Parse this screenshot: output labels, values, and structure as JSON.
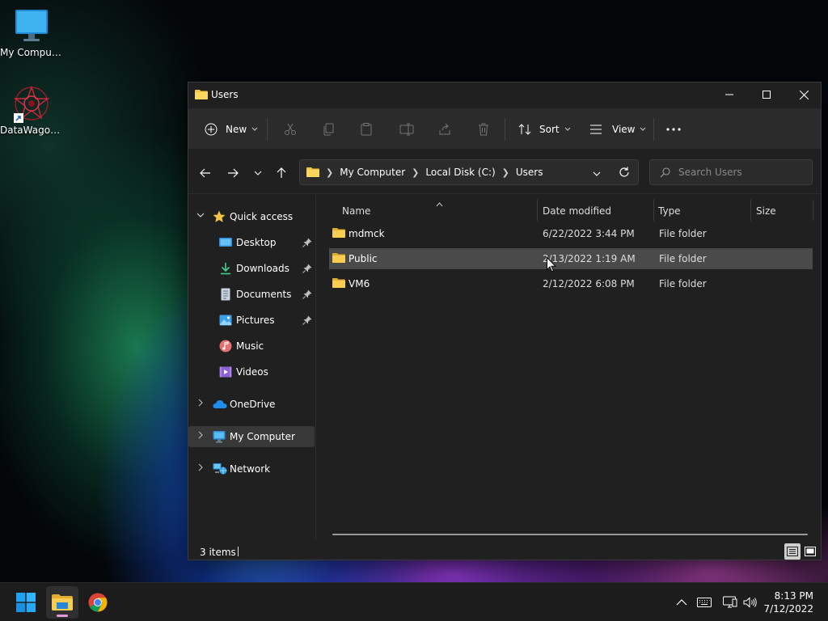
{
  "desktop": {
    "icons": [
      {
        "label": "My Computer",
        "icon": "monitor-icon"
      },
      {
        "label": "DataWagon...",
        "icon": "datawagon-app-icon"
      }
    ]
  },
  "window": {
    "title": "Users",
    "controls": {
      "minimize": "minimize-icon",
      "maximize": "maximize-icon",
      "close": "close-icon"
    }
  },
  "toolbar": {
    "new_label": "New",
    "sort_label": "Sort",
    "view_label": "View",
    "disabled_actions": [
      "cut",
      "copy",
      "paste",
      "rename",
      "share",
      "delete"
    ]
  },
  "address": {
    "crumbs": [
      "My Computer",
      "Local Disk (C:)",
      "Users"
    ],
    "search_placeholder": "Search Users"
  },
  "nav": {
    "quick_access": "Quick access",
    "items": [
      {
        "label": "Desktop",
        "pinned": true
      },
      {
        "label": "Downloads",
        "pinned": true
      },
      {
        "label": "Documents",
        "pinned": true
      },
      {
        "label": "Pictures",
        "pinned": true
      },
      {
        "label": "Music",
        "pinned": false
      },
      {
        "label": "Videos",
        "pinned": false
      }
    ],
    "onedrive": "OneDrive",
    "my_computer": "My Computer",
    "network": "Network",
    "selected": "My Computer"
  },
  "files": {
    "columns": [
      "Name",
      "Date modified",
      "Type",
      "Size"
    ],
    "sort_column": "Name",
    "rows": [
      {
        "name": "mdmck",
        "date": "6/22/2022 3:44 PM",
        "type": "File folder",
        "size": ""
      },
      {
        "name": "Public",
        "date": "2/13/2022 1:19 AM",
        "type": "File folder",
        "size": ""
      },
      {
        "name": "VM6",
        "date": "2/12/2022 6:08 PM",
        "type": "File folder",
        "size": ""
      }
    ],
    "hovered": "Public"
  },
  "status": {
    "count_text": "3 items"
  },
  "taskbar": {
    "apps": [
      "start-button",
      "file-explorer",
      "chrome"
    ],
    "active_app": "file-explorer",
    "time": "8:13 PM",
    "date": "7/12/2022"
  },
  "colors": {
    "window_bg": "#202020",
    "toolbar_bg": "#2b2b2b",
    "folder_yellow": "#f3c444",
    "selected_bg": "#383838",
    "hover_bg": "#4a4a4a",
    "accent_blue": "#4cc2ff"
  }
}
